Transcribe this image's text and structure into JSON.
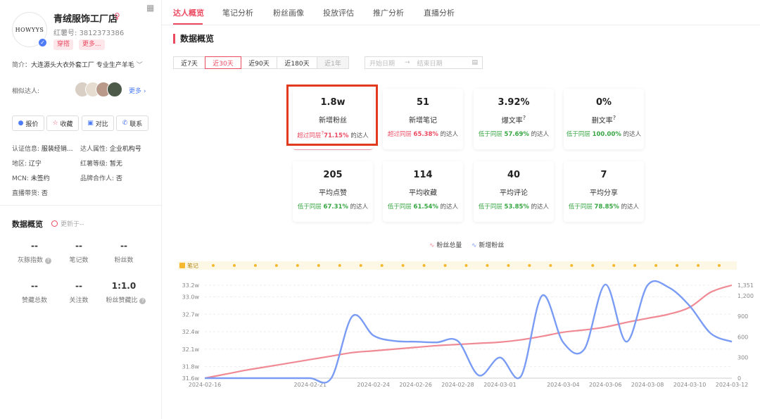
{
  "profile": {
    "avatar_text": "HOWYYS",
    "name": "青绒服饰工厂店",
    "red_id_label": "红薯号:",
    "red_id": "3812373386",
    "tags": [
      "穿搭",
      "更多..."
    ],
    "intro_label": "简介：",
    "intro": "大连源头大衣外套工厂 专业生产羊毛",
    "similar_label": "相似达人:",
    "more_label": "更多",
    "buttons": [
      "报价",
      "收藏",
      "对比",
      "联系"
    ],
    "info": [
      {
        "label": "认证信息:",
        "value": "服装经销..."
      },
      {
        "label": "达人属性:",
        "value": "企业机构号"
      },
      {
        "label": "地区:",
        "value": "辽宁"
      },
      {
        "label": "红薯等级:",
        "value": "暂无"
      },
      {
        "label": "MCN:",
        "value": "未签约"
      },
      {
        "label": "品牌合作人:",
        "value": "否"
      },
      {
        "label": "直播带货:",
        "value": "否"
      }
    ]
  },
  "left_stats": {
    "title": "数据概览",
    "updated": "更新于--",
    "items": [
      {
        "value": "--",
        "label": "灰豚指数"
      },
      {
        "value": "--",
        "label": "笔记数"
      },
      {
        "value": "--",
        "label": "粉丝数"
      },
      {
        "value": "--",
        "label": "赞藏总数"
      },
      {
        "value": "--",
        "label": "关注数"
      },
      {
        "value": "1:1.0",
        "label": "粉丝赞藏比"
      }
    ]
  },
  "tabs": [
    "达人概览",
    "笔记分析",
    "粉丝画像",
    "投放评估",
    "推广分析",
    "直播分析"
  ],
  "section_title": "数据概览",
  "ranges": [
    "近7天",
    "近30天",
    "近90天",
    "近180天",
    "近1年"
  ],
  "date_start": "开始日期",
  "date_end": "结束日期",
  "cards": [
    {
      "value": "1.8w",
      "label": "新增粉丝",
      "cmp": "超过同层",
      "pct": "71.15%",
      "suffix": "的达人"
    },
    {
      "value": "51",
      "label": "新增笔记",
      "cmp": "超过同层",
      "pct": "65.38%",
      "suffix": "的达人"
    },
    {
      "value": "3.92%",
      "label": "爆文率",
      "cmp": "低于同层",
      "pct": "57.69%",
      "suffix": "的达人"
    },
    {
      "value": "0%",
      "label": "删文率",
      "cmp": "低于同层",
      "pct": "100.00%",
      "suffix": "的达人"
    },
    {
      "value": "205",
      "label": "平均点赞",
      "cmp": "低于同层",
      "pct": "67.31%",
      "suffix": "的达人"
    },
    {
      "value": "114",
      "label": "平均收藏",
      "cmp": "低于同层",
      "pct": "61.54%",
      "suffix": "的达人"
    },
    {
      "value": "40",
      "label": "平均评论",
      "cmp": "低于同层",
      "pct": "53.85%",
      "suffix": "的达人"
    },
    {
      "value": "7",
      "label": "平均分享",
      "cmp": "低于同层",
      "pct": "78.85%",
      "suffix": "的达人"
    }
  ],
  "colors": {
    "accent": "#ec4a61",
    "total_line": "#f08a94",
    "new_line": "#7a9cf5",
    "notes_dot": "#f5b82e"
  },
  "chart_data": {
    "type": "line",
    "legend": [
      "粉丝总量",
      "新增粉丝"
    ],
    "notes_label": "笔记",
    "x_ticks": [
      "2024-02-16",
      "2024-02-21",
      "2024-02-24",
      "2024-02-26",
      "2024-02-28",
      "2024-03-01",
      "2024-03-04",
      "2024-03-06",
      "2024-03-08",
      "2024-03-10",
      "2024-03-12"
    ],
    "y_left_ticks": [
      "33.2w",
      "33.0w",
      "32.7w",
      "32.4w",
      "32.1w",
      "31.8w",
      "31.6w"
    ],
    "y_right_ticks": [
      "1,351",
      "1,200",
      "900",
      "600",
      "300",
      "0"
    ],
    "y_left_range": [
      31.6,
      33.2
    ],
    "y_right_range": [
      0,
      1351
    ],
    "x": [
      "2024-02-16",
      "2024-02-17",
      "2024-02-18",
      "2024-02-19",
      "2024-02-20",
      "2024-02-21",
      "2024-02-22",
      "2024-02-23",
      "2024-02-24",
      "2024-02-25",
      "2024-02-26",
      "2024-02-27",
      "2024-02-28",
      "2024-02-29",
      "2024-03-01",
      "2024-03-02",
      "2024-03-03",
      "2024-03-04",
      "2024-03-05",
      "2024-03-06",
      "2024-03-07",
      "2024-03-08",
      "2024-03-09",
      "2024-03-10",
      "2024-03-11",
      "2024-03-12"
    ],
    "series": [
      {
        "name": "粉丝总量",
        "axis": "left",
        "values": [
          31.6,
          31.67,
          31.74,
          31.8,
          31.86,
          31.92,
          31.98,
          32.04,
          32.07,
          32.1,
          32.13,
          32.16,
          32.18,
          32.2,
          32.22,
          32.26,
          32.32,
          32.39,
          32.43,
          32.48,
          32.56,
          32.63,
          32.7,
          32.82,
          33.08,
          33.2
        ]
      },
      {
        "name": "新增粉丝",
        "axis": "right",
        "values": [
          0,
          0,
          0,
          0,
          0,
          0,
          0,
          900,
          620,
          540,
          530,
          520,
          540,
          40,
          300,
          30,
          1200,
          520,
          420,
          1360,
          530,
          1350,
          1320,
          1050,
          650,
          530
        ]
      }
    ],
    "note_dates": [
      "2024-02-16",
      "2024-02-17",
      "2024-02-18",
      "2024-02-19",
      "2024-02-20",
      "2024-02-21",
      "2024-02-22",
      "2024-02-23",
      "2024-02-24",
      "2024-02-25",
      "2024-02-26",
      "2024-02-27",
      "2024-02-28",
      "2024-02-29",
      "2024-03-01",
      "2024-03-02",
      "2024-03-03",
      "2024-03-04",
      "2024-03-05",
      "2024-03-06",
      "2024-03-07",
      "2024-03-08",
      "2024-03-09",
      "2024-03-10",
      "2024-03-11"
    ]
  }
}
